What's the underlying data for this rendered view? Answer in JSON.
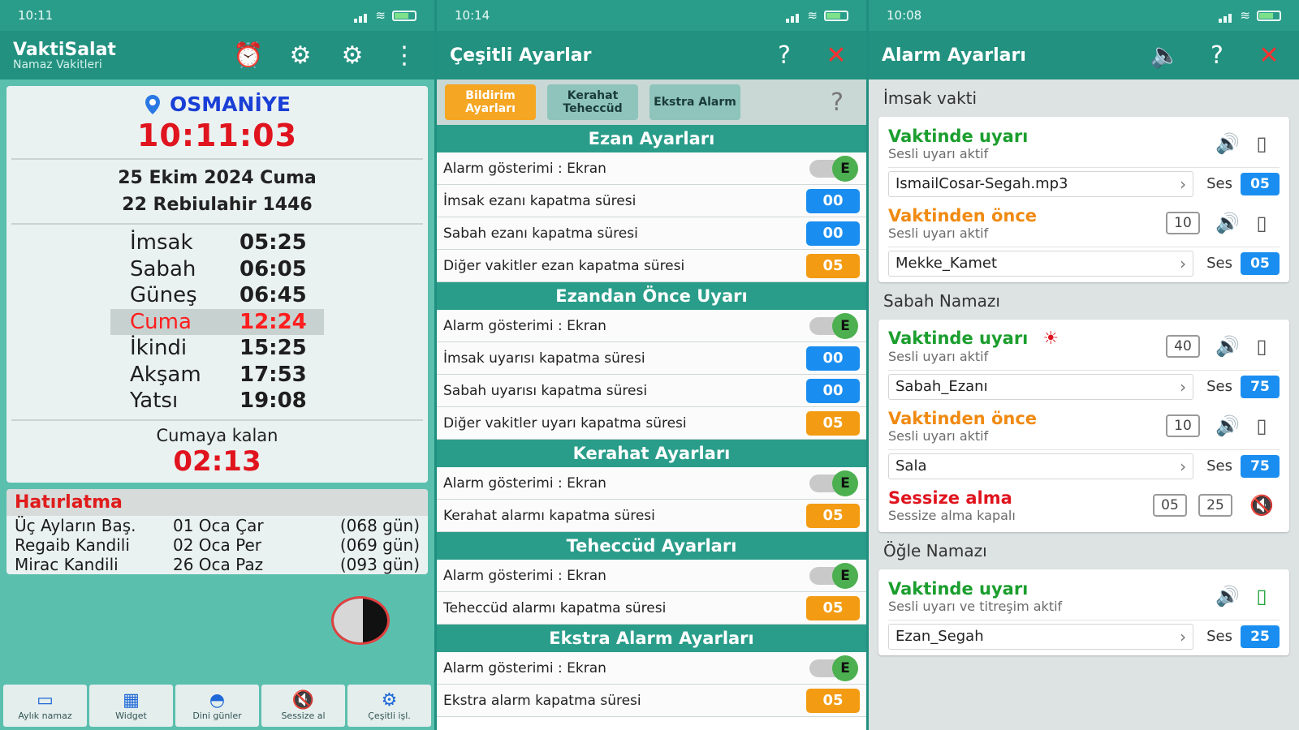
{
  "screen1": {
    "status_time": "10:11",
    "app_title": "VaktiSalat",
    "app_subtitle": "Namaz Vakitleri",
    "city": "OSMANİYE",
    "clock": "10:11:03",
    "date_gregorian": "25 Ekim 2024 Cuma",
    "date_hijri": "22 Rebiulahir 1446",
    "prayers": [
      {
        "name": "İmsak",
        "time": "05:25"
      },
      {
        "name": "Sabah",
        "time": "06:05"
      },
      {
        "name": "Güneş",
        "time": "06:45"
      },
      {
        "name": "Cuma",
        "time": "12:24"
      },
      {
        "name": "İkindi",
        "time": "15:25"
      },
      {
        "name": "Akşam",
        "time": "17:53"
      },
      {
        "name": "Yatsı",
        "time": "19:08"
      }
    ],
    "remaining_label": "Cumaya kalan",
    "remaining": "02:13",
    "reminder_title": "Hatırlatma",
    "reminders": [
      {
        "name": "Üç Ayların Baş.",
        "date": "01 Oca Çar",
        "days": "(068 gün)"
      },
      {
        "name": "Regaib Kandili",
        "date": "02 Oca Per",
        "days": "(069 gün)"
      },
      {
        "name": "Mirac Kandili",
        "date": "26 Oca Paz",
        "days": "(093 gün)"
      }
    ],
    "nav": [
      {
        "label": "Aylık namaz",
        "icon": "calendar-icon"
      },
      {
        "label": "Widget",
        "icon": "widget-icon"
      },
      {
        "label": "Dini günler",
        "icon": "mosque-icon"
      },
      {
        "label": "Sessize al",
        "icon": "mute-icon"
      },
      {
        "label": "Çeşitli işl.",
        "icon": "gear-icon"
      }
    ]
  },
  "screen2": {
    "status_time": "10:14",
    "title": "Çeşitli Ayarlar",
    "tabs": [
      {
        "label": "Bildirim Ayarları"
      },
      {
        "label": "Kerahat Teheccüd"
      },
      {
        "label": "Ekstra Alarm"
      }
    ],
    "sections": [
      {
        "title": "Ezan Ayarları",
        "rows": [
          {
            "label": "Alarm gösterimi : Ekran",
            "type": "toggle",
            "value": "E"
          },
          {
            "label": "İmsak ezanı kapatma süresi",
            "type": "pill",
            "value": "00",
            "color": "blue"
          },
          {
            "label": "Sabah ezanı kapatma süresi",
            "type": "pill",
            "value": "00",
            "color": "blue"
          },
          {
            "label": "Diğer vakitler ezan kapatma süresi",
            "type": "pill",
            "value": "05",
            "color": "orange"
          }
        ]
      },
      {
        "title": "Ezandan Önce Uyarı",
        "rows": [
          {
            "label": "Alarm gösterimi : Ekran",
            "type": "toggle",
            "value": "E"
          },
          {
            "label": "İmsak uyarısı kapatma süresi",
            "type": "pill",
            "value": "00",
            "color": "blue"
          },
          {
            "label": "Sabah uyarısı kapatma süresi",
            "type": "pill",
            "value": "00",
            "color": "blue"
          },
          {
            "label": "Diğer vakitler uyarı kapatma süresi",
            "type": "pill",
            "value": "05",
            "color": "orange"
          }
        ]
      },
      {
        "title": "Kerahat Ayarları",
        "rows": [
          {
            "label": "Alarm gösterimi : Ekran",
            "type": "toggle",
            "value": "E"
          },
          {
            "label": "Kerahat alarmı kapatma süresi",
            "type": "pill",
            "value": "05",
            "color": "orange"
          }
        ]
      },
      {
        "title": "Teheccüd Ayarları",
        "rows": [
          {
            "label": "Alarm gösterimi : Ekran",
            "type": "toggle",
            "value": "E"
          },
          {
            "label": "Teheccüd alarmı kapatma süresi",
            "type": "pill",
            "value": "05",
            "color": "orange"
          }
        ]
      },
      {
        "title": "Ekstra Alarm Ayarları",
        "rows": [
          {
            "label": "Alarm gösterimi : Ekran",
            "type": "toggle",
            "value": "E"
          },
          {
            "label": "Ekstra alarm kapatma süresi",
            "type": "pill",
            "value": "05",
            "color": "orange"
          }
        ]
      }
    ]
  },
  "screen3": {
    "status_time": "10:08",
    "title": "Alarm Ayarları",
    "groups": [
      {
        "title": "İmsak vakti",
        "items": [
          {
            "title": "Vaktinde uyarı",
            "color": "green",
            "status": "Sesli uyarı aktif",
            "minutes": "",
            "sun": false,
            "vibrate": false,
            "file": "IsmailCosar-Segah.mp3",
            "vol_label": "Ses",
            "volume": "05"
          },
          {
            "title": "Vaktinden önce",
            "color": "orange",
            "status": "Sesli uyarı aktif",
            "minutes": "10",
            "sun": false,
            "vibrate": false,
            "file": "Mekke_Kamet",
            "vol_label": "Ses",
            "volume": "05"
          }
        ]
      },
      {
        "title": "Sabah Namazı",
        "items": [
          {
            "title": "Vaktinde uyarı",
            "color": "green",
            "status": "Sesli uyarı aktif",
            "minutes": "40",
            "sun": true,
            "vibrate": false,
            "file": "Sabah_Ezanı",
            "vol_label": "Ses",
            "volume": "75"
          },
          {
            "title": "Vaktinden önce",
            "color": "orange",
            "status": "Sesli uyarı aktif",
            "minutes": "10",
            "sun": false,
            "vibrate": false,
            "file": "Sala",
            "vol_label": "Ses",
            "volume": "75"
          }
        ],
        "silent": {
          "title": "Sessize alma",
          "status": "Sessize alma kapalı",
          "a": "05",
          "b": "25"
        }
      },
      {
        "title": "Öğle Namazı",
        "items": [
          {
            "title": "Vaktinde uyarı",
            "color": "green",
            "status": "Sesli uyarı ve titreşim aktif",
            "minutes": "",
            "sun": false,
            "vibrate": true,
            "file": "Ezan_Segah",
            "vol_label": "Ses",
            "volume": "25"
          }
        ]
      }
    ]
  }
}
